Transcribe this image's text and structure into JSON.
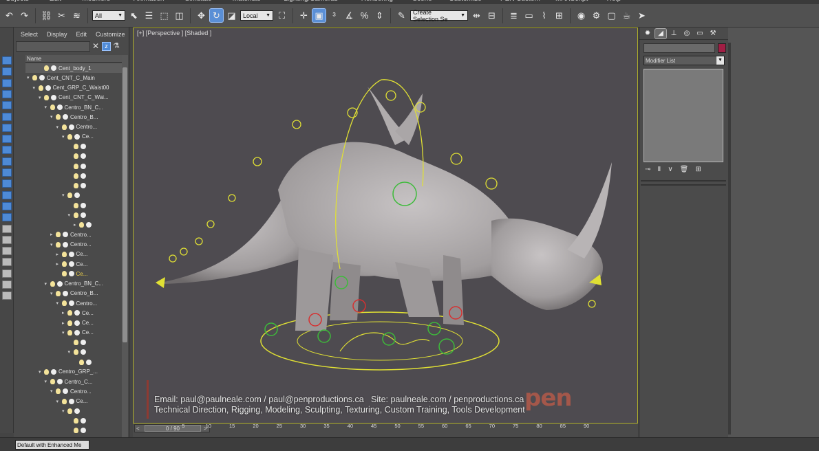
{
  "menu": [
    "Objects",
    "Edit",
    "Modifiers",
    "Animation",
    "Simulate",
    "Materials",
    "Lighting/Cameras",
    "Rendering",
    "Scene",
    "Customize",
    "PEN Custom",
    "MAXScript",
    "Help"
  ],
  "toolbar": {
    "selection_filter": "All",
    "ref_coord": "Local",
    "named_selection": "Create Selection Se"
  },
  "explorer": {
    "menu": [
      "Select",
      "Display",
      "Edit",
      "Customize"
    ],
    "column_header": "Name",
    "rows": [
      {
        "label": "Cent_body_1",
        "indent": 2,
        "twisty": "",
        "highlight": false,
        "selected": true
      },
      {
        "label": "Cent_CNT_C_Main",
        "indent": 0,
        "twisty": "▾",
        "highlight": false,
        "selected": false
      },
      {
        "label": "Cent_GRP_C_Waist00",
        "indent": 1,
        "twisty": "▾",
        "highlight": false,
        "selected": false
      },
      {
        "label": "Cent_CNT_C_Wai...",
        "indent": 2,
        "twisty": "▾",
        "highlight": false,
        "selected": false
      },
      {
        "label": "Centro_BN_C...",
        "indent": 3,
        "twisty": "▾",
        "highlight": false,
        "selected": false
      },
      {
        "label": "Centro_B...",
        "indent": 4,
        "twisty": "▾",
        "highlight": false,
        "selected": false
      },
      {
        "label": "Centro...",
        "indent": 5,
        "twisty": "▾",
        "highlight": false,
        "selected": false
      },
      {
        "label": "Ce...",
        "indent": 6,
        "twisty": "▾",
        "highlight": false,
        "selected": false
      },
      {
        "label": "",
        "indent": 7,
        "twisty": "",
        "highlight": false,
        "selected": false
      },
      {
        "label": "",
        "indent": 7,
        "twisty": "",
        "highlight": false,
        "selected": false
      },
      {
        "label": "",
        "indent": 7,
        "twisty": "",
        "highlight": false,
        "selected": false
      },
      {
        "label": "",
        "indent": 7,
        "twisty": "",
        "highlight": false,
        "selected": false
      },
      {
        "label": "",
        "indent": 7,
        "twisty": "",
        "highlight": false,
        "selected": false
      },
      {
        "label": "",
        "indent": 6,
        "twisty": "▾",
        "highlight": false,
        "selected": false
      },
      {
        "label": "",
        "indent": 7,
        "twisty": "",
        "highlight": false,
        "selected": false
      },
      {
        "label": "",
        "indent": 7,
        "twisty": "▾",
        "highlight": false,
        "selected": false
      },
      {
        "label": "",
        "indent": 8,
        "twisty": "▸",
        "highlight": false,
        "selected": false
      },
      {
        "label": "Centro...",
        "indent": 4,
        "twisty": "▸",
        "highlight": false,
        "selected": false
      },
      {
        "label": "Centro...",
        "indent": 4,
        "twisty": "▾",
        "highlight": false,
        "selected": false
      },
      {
        "label": "Ce...",
        "indent": 5,
        "twisty": "▸",
        "highlight": false,
        "selected": false
      },
      {
        "label": "Ce...",
        "indent": 5,
        "twisty": "▸",
        "highlight": false,
        "selected": false
      },
      {
        "label": "Ce...",
        "indent": 5,
        "twisty": "",
        "highlight": true,
        "selected": false
      },
      {
        "label": "Centro_BN_C...",
        "indent": 3,
        "twisty": "▾",
        "highlight": false,
        "selected": false
      },
      {
        "label": "Centro_B...",
        "indent": 4,
        "twisty": "▾",
        "highlight": false,
        "selected": false
      },
      {
        "label": "Centro...",
        "indent": 5,
        "twisty": "▾",
        "highlight": false,
        "selected": false
      },
      {
        "label": "Ce...",
        "indent": 6,
        "twisty": "▸",
        "highlight": false,
        "selected": false
      },
      {
        "label": "Ce...",
        "indent": 6,
        "twisty": "▸",
        "highlight": false,
        "selected": false
      },
      {
        "label": "Ce...",
        "indent": 6,
        "twisty": "▾",
        "highlight": false,
        "selected": false
      },
      {
        "label": "",
        "indent": 7,
        "twisty": "",
        "highlight": false,
        "selected": false
      },
      {
        "label": "",
        "indent": 7,
        "twisty": "▾",
        "highlight": false,
        "selected": false
      },
      {
        "label": "",
        "indent": 8,
        "twisty": "",
        "highlight": false,
        "selected": false
      },
      {
        "label": "Centro_GRP_...",
        "indent": 2,
        "twisty": "▾",
        "highlight": false,
        "selected": false
      },
      {
        "label": "Centro_C...",
        "indent": 3,
        "twisty": "▾",
        "highlight": false,
        "selected": false
      },
      {
        "label": "Centro...",
        "indent": 4,
        "twisty": "▾",
        "highlight": false,
        "selected": false
      },
      {
        "label": "Ce...",
        "indent": 5,
        "twisty": "▾",
        "highlight": false,
        "selected": false
      },
      {
        "label": "",
        "indent": 6,
        "twisty": "▾",
        "highlight": false,
        "selected": false
      },
      {
        "label": "",
        "indent": 7,
        "twisty": "",
        "highlight": false,
        "selected": false
      },
      {
        "label": "",
        "indent": 7,
        "twisty": "",
        "highlight": false,
        "selected": false
      }
    ]
  },
  "statusbar": {
    "workspace": "Default with Enhanced Me"
  },
  "viewport": {
    "label": "[+] [Perspective ] [Shaded ]",
    "watermark_line1_left": "Email: paul@paulneale.com / paul@penproductions.ca",
    "watermark_line1_right": "Site: paulneale.com / penproductions.ca",
    "watermark_line2": "Technical Direction, Rigging, Modeling, Sculpting, Texturing, Custom Training, Tools Development",
    "logo": "pen",
    "colors": {
      "spline": "#e0e034",
      "control_green": "#3dbb3a",
      "control_red": "#d63030",
      "body": "#a9a5a6"
    }
  },
  "timeline": {
    "frame_readout": "0 / 90",
    "ticks": [
      "0",
      "5",
      "10",
      "15",
      "20",
      "25",
      "30",
      "35",
      "40",
      "45",
      "50",
      "55",
      "60",
      "65",
      "70",
      "75",
      "80",
      "85",
      "90"
    ]
  },
  "command_panel": {
    "modifier_list": "Modifier List"
  }
}
